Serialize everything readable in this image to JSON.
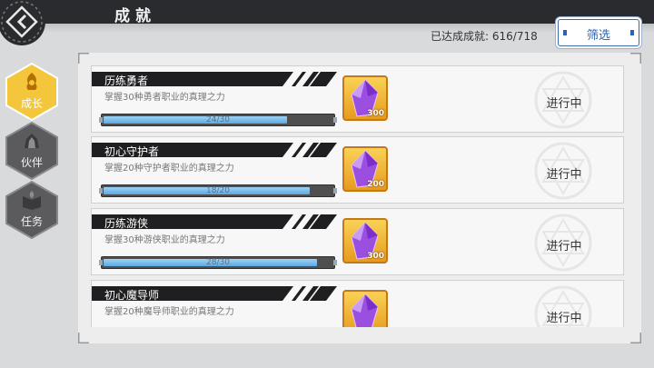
{
  "header": {
    "title": "成就",
    "achieved_label": "已达成成就:",
    "achieved_value": "616/718",
    "filter_label": "筛选"
  },
  "sidebar": {
    "items": [
      {
        "label": "成长",
        "icon": "growth-icon",
        "active": true
      },
      {
        "label": "伙伴",
        "icon": "partner-icon",
        "active": false
      },
      {
        "label": "任务",
        "icon": "quest-book-icon",
        "active": false
      }
    ]
  },
  "achievements": [
    {
      "name": "历练勇者",
      "desc": "掌握30种勇者职业的真理之力",
      "progress_text": "24/30",
      "progress": 0.8,
      "reward_qty": "300",
      "status": "进行中"
    },
    {
      "name": "初心守护者",
      "desc": "掌握20种守护者职业的真理之力",
      "progress_text": "18/20",
      "progress": 0.9,
      "reward_qty": "200",
      "status": "进行中"
    },
    {
      "name": "历练游侠",
      "desc": "掌握30种游侠职业的真理之力",
      "progress_text": "28/30",
      "progress": 0.933,
      "reward_qty": "300",
      "status": "进行中"
    },
    {
      "name": "初心魔导师",
      "desc": "掌握20种魔导师职业的真理之力",
      "progress_text": "",
      "progress": 0,
      "reward_qty": "",
      "status": "进行中"
    }
  ],
  "colors": {
    "accent_active": "#f2c63a",
    "tab_inactive": "#5b5b5e",
    "progress_fill": "#5aa9e2",
    "reward_frame": "#f9d256",
    "crystal": "#a45ae6",
    "filter_border": "#3a6aa8"
  }
}
